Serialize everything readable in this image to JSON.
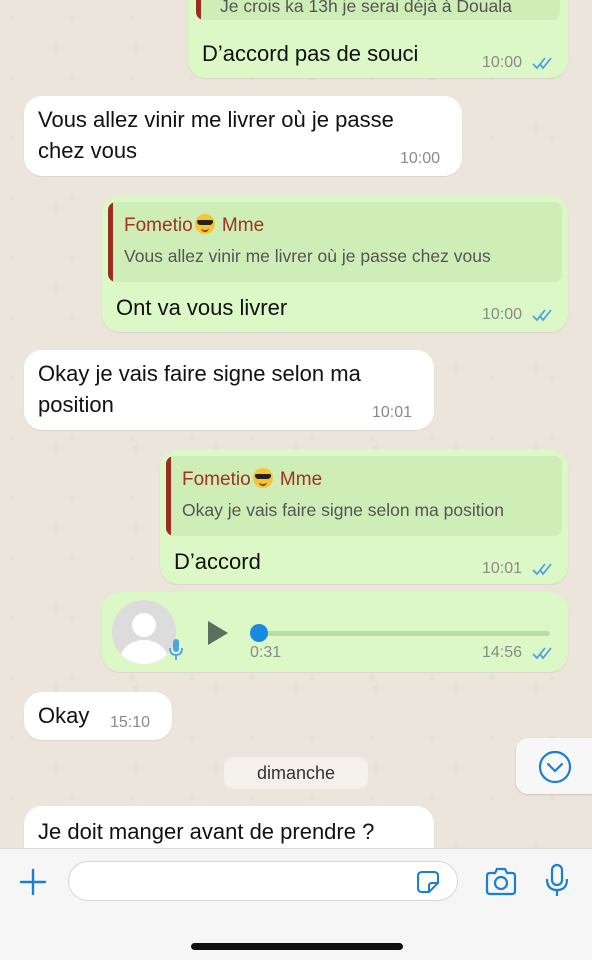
{
  "messages": [
    {
      "id": "m0",
      "type": "out",
      "quote_fragment": "Je crois ka 13h je serai déjà à Douala",
      "text": "D’accord pas de souci",
      "time": "10:00"
    },
    {
      "id": "m1",
      "type": "in",
      "text_lines": [
        "Vous allez vinir me livrer où je passe",
        "chez vous"
      ],
      "time": "10:00"
    },
    {
      "id": "m2",
      "type": "out",
      "quote_name": "Fometio",
      "quote_name_suffix": "Mme",
      "quote_text": "Vous allez vinir me livrer où je passe chez vous",
      "text": "Ont va vous livrer",
      "time": "10:00"
    },
    {
      "id": "m3",
      "type": "in",
      "text_lines": [
        "Okay je vais faire signe selon ma",
        "position"
      ],
      "time": "10:01"
    },
    {
      "id": "m4",
      "type": "out",
      "quote_name": "Fometio",
      "quote_name_suffix": "Mme",
      "quote_text": "Okay je vais faire signe selon ma position",
      "text": "D’accord",
      "time": "10:01"
    },
    {
      "id": "m5",
      "type": "voice",
      "duration": "0:31",
      "progress": 0.0,
      "time": "14:56"
    },
    {
      "id": "m6",
      "type": "in",
      "text": "Okay",
      "time": "15:10"
    },
    {
      "id": "m7",
      "type": "in",
      "text": "Je doit manger avant de prendre ?"
    }
  ],
  "day_separator": "dimanche",
  "colors": {
    "outgoing_bubble": "#dcf8c6",
    "incoming_bubble": "#ffffff",
    "read_ticks": "#4fa3e0",
    "quote_name": "#a0341e",
    "accent_blue": "#1a7fd1"
  },
  "icons": {
    "add": "plus-icon",
    "sticker": "sticker-icon",
    "camera": "camera-icon",
    "mic": "mic-icon",
    "scroll_down": "chevron-down-icon",
    "play": "play-icon",
    "avatar": "avatar-icon",
    "emoji": "sunglasses-emoji-icon"
  }
}
